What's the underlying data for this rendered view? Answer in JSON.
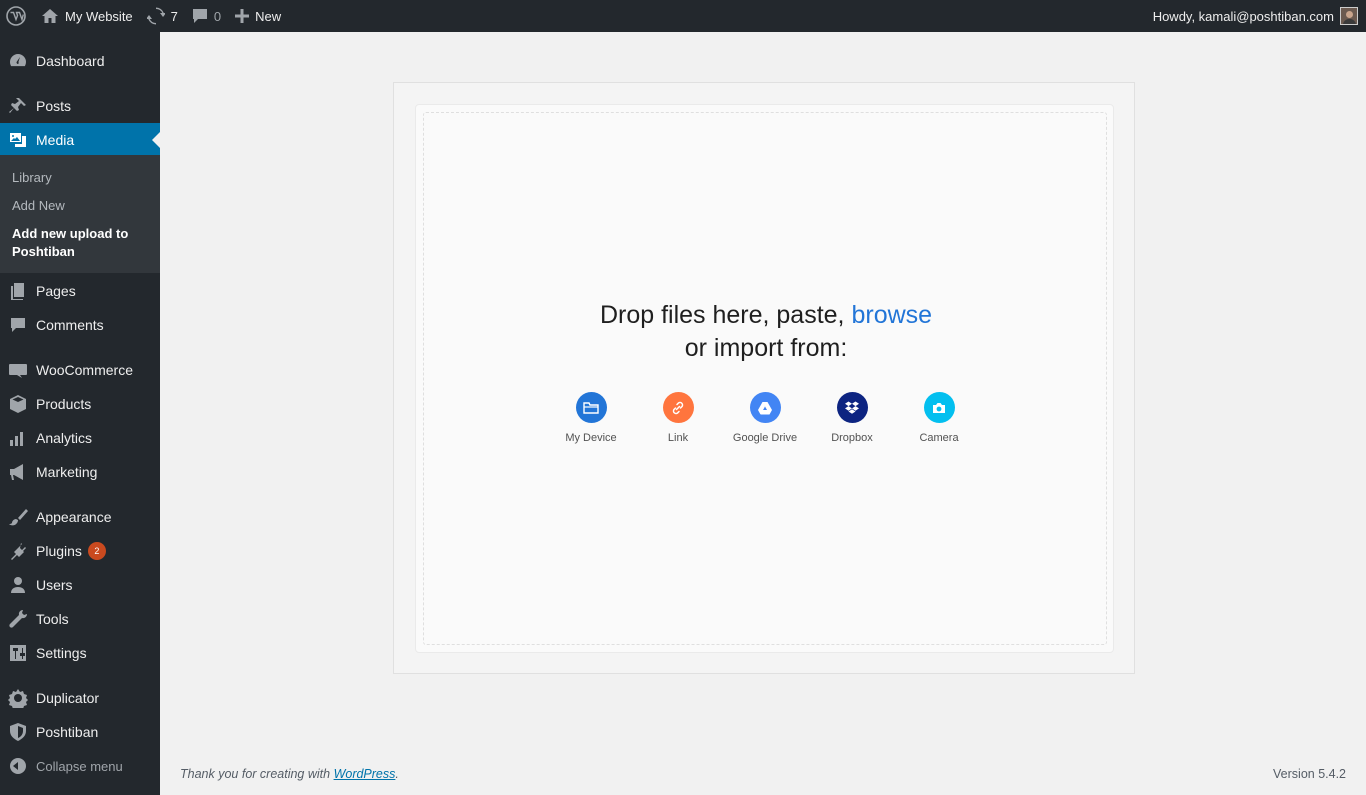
{
  "adminbar": {
    "site_name": "My Website",
    "updates_count": "7",
    "comments_count": "0",
    "new_label": "New",
    "greeting": "Howdy, kamali@poshtiban.com"
  },
  "sidebar": {
    "dashboard": "Dashboard",
    "posts": "Posts",
    "media": "Media",
    "media_sub": {
      "library": "Library",
      "add_new": "Add New",
      "add_upload": "Add new upload to Poshtiban"
    },
    "pages": "Pages",
    "comments": "Comments",
    "woocommerce": "WooCommerce",
    "products": "Products",
    "analytics": "Analytics",
    "marketing": "Marketing",
    "appearance": "Appearance",
    "plugins": "Plugins",
    "plugins_badge": "2",
    "users": "Users",
    "tools": "Tools",
    "settings": "Settings",
    "duplicator": "Duplicator",
    "poshtiban": "Poshtiban",
    "collapse": "Collapse menu"
  },
  "uploader": {
    "drop_text": "Drop files here, paste,",
    "browse": "browse",
    "import_text": "or import from:",
    "sources": {
      "my_device": "My Device",
      "link": "Link",
      "google_drive": "Google Drive",
      "dropbox": "Dropbox",
      "camera": "Camera"
    }
  },
  "footer": {
    "thanks_prefix": "Thank you for creating with",
    "thanks_link": "WordPress",
    "thanks_suffix": ".",
    "version": "Version 5.4.2"
  },
  "colors": {
    "sidebar_bg": "#23282d",
    "active_menu": "#0073aa",
    "browse_link": "#2275d7",
    "my_device": "#2275d7",
    "link": "#ff753e",
    "google_drive": "#4285f4",
    "dropbox": "#0d2481",
    "camera": "#03bfef",
    "badge": "#ca4a1f"
  }
}
